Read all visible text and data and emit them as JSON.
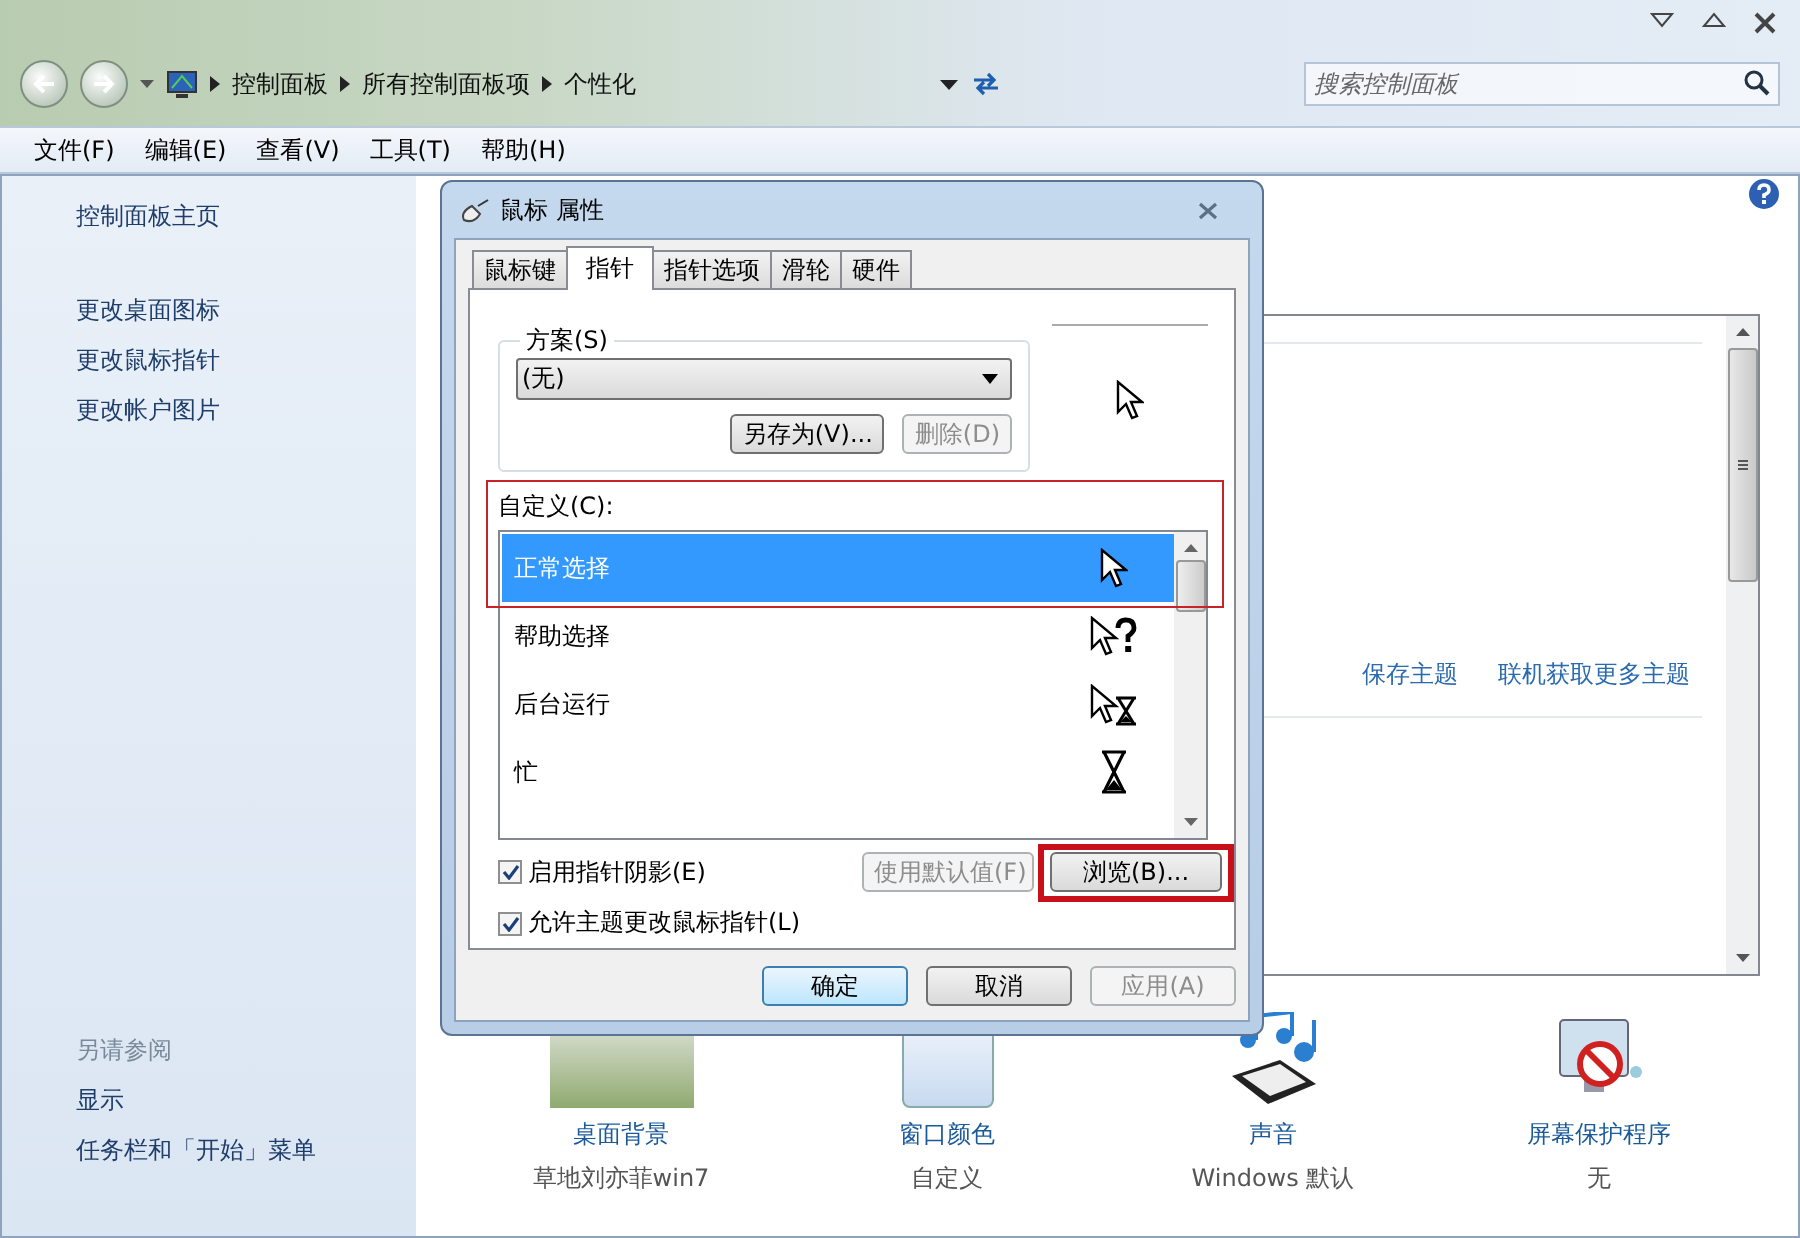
{
  "address_bar": {
    "breadcrumbs": [
      "控制面板",
      "所有控制面板项",
      "个性化"
    ]
  },
  "search": {
    "placeholder": "搜索控制面板"
  },
  "menu": [
    "文件(F)",
    "编辑(E)",
    "查看(V)",
    "工具(T)",
    "帮助(H)"
  ],
  "sidebar": {
    "links": [
      "控制面板主页",
      "更改桌面图标",
      "更改鼠标指针",
      "更改帐户图片"
    ],
    "see_also": {
      "title": "另请参阅",
      "links": [
        "显示",
        "任务栏和「开始」菜单"
      ]
    }
  },
  "theme_panel": {
    "links": [
      "保存主题",
      "联机获取更多主题"
    ]
  },
  "bottom_items": [
    {
      "kind": "wallpaper",
      "label": "桌面背景",
      "sublabel": "草地刘亦菲win7"
    },
    {
      "kind": "color",
      "label": "窗口颜色",
      "sublabel": "自定义"
    },
    {
      "kind": "sound",
      "label": "声音",
      "sublabel": "Windows 默认"
    },
    {
      "kind": "screensaver",
      "label": "屏幕保护程序",
      "sublabel": "无"
    }
  ],
  "dialog": {
    "title": "鼠标 属性",
    "tabs": [
      {
        "label": "鼠标键",
        "selected": false
      },
      {
        "label": "指针",
        "selected": true
      },
      {
        "label": "指针选项",
        "selected": false
      },
      {
        "label": "滑轮",
        "selected": false
      },
      {
        "label": "硬件",
        "selected": false
      }
    ],
    "scheme": {
      "label": "方案(S)",
      "value": "(无)",
      "buttons": [
        {
          "label": "另存为(V)...",
          "disabled": false
        },
        {
          "label": "删除(D)",
          "disabled": true
        }
      ]
    },
    "custom": {
      "label": "自定义(C):",
      "highlighted": true,
      "rows": [
        {
          "name": "正常选择",
          "kind": "arrow",
          "selected": true
        },
        {
          "name": "帮助选择",
          "kind": "help",
          "selected": false
        },
        {
          "name": "后台运行",
          "kind": "working",
          "selected": false
        },
        {
          "name": "忙",
          "kind": "busy",
          "selected": false
        }
      ]
    },
    "checkboxes": [
      {
        "label": "启用指针阴影(E)",
        "checked": true
      },
      {
        "label": "允许主题更改鼠标指针(L)",
        "checked": true
      }
    ],
    "row_buttons": [
      {
        "label": "使用默认值(F)",
        "disabled": true,
        "highlighted": false
      },
      {
        "label": "浏览(B)...",
        "disabled": false,
        "highlighted": true
      }
    ],
    "footer_buttons": [
      {
        "label": "确定",
        "disabled": false,
        "default": true
      },
      {
        "label": "取消",
        "disabled": false,
        "default": false
      },
      {
        "label": "应用(A)",
        "disabled": true,
        "default": false
      }
    ]
  }
}
